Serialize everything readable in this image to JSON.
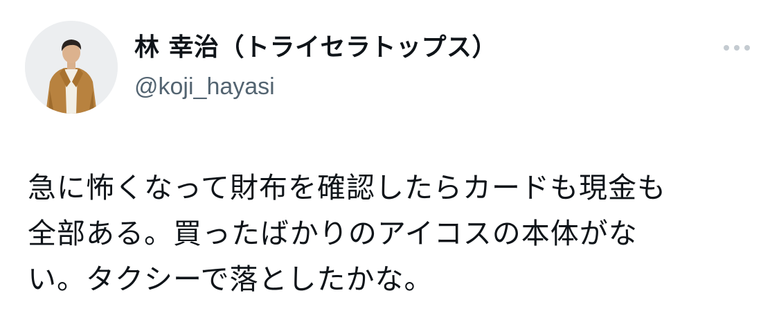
{
  "tweet": {
    "author": {
      "display_name": "林 幸治（トライセラトップス）",
      "handle": "@koji_hayasi",
      "avatar_icon": "profile-photo"
    },
    "more_icon": "more-horizontal-icon",
    "text_lines": [
      "急に怖くなって財布を確認したらカードも現金も",
      "全部ある。買ったばかりのアイコスの本体がな",
      "い。タクシーで落としたかな。"
    ]
  },
  "colors": {
    "text": "#0f1419",
    "secondary_text": "#536471",
    "more_dots": "#c4cbd1",
    "background": "#ffffff"
  }
}
